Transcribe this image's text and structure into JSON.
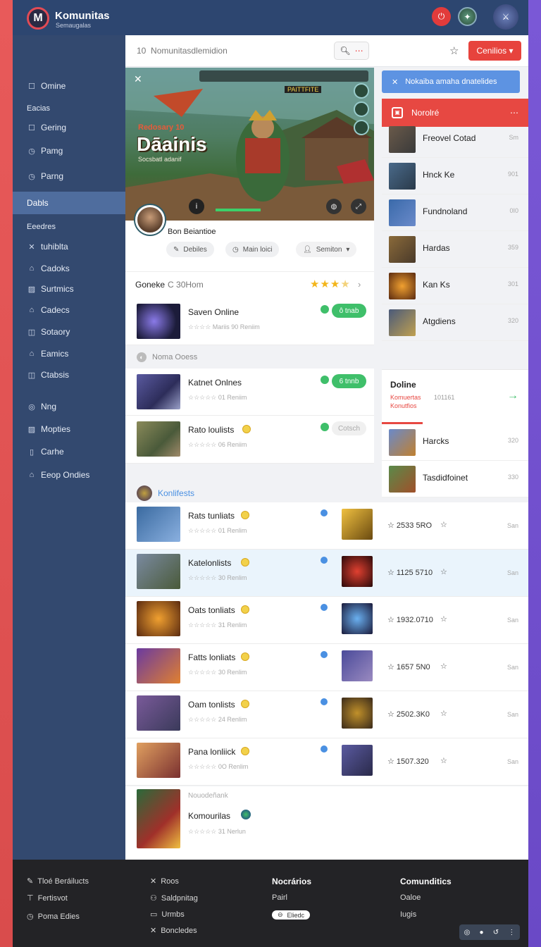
{
  "app": {
    "title": "Komunitas",
    "subtitle": "Semaugalas"
  },
  "topbar": {
    "icons": [
      "notification-icon",
      "guild-badge-icon",
      "sword-emblem-icon"
    ]
  },
  "sidebar": {
    "items": [
      {
        "label": "Omine",
        "icon": "square-icon"
      },
      {
        "label": "Eacias",
        "icon": ""
      },
      {
        "label": "Gering",
        "icon": "square-icon"
      },
      {
        "label": "Pamg",
        "icon": "clock-icon"
      },
      {
        "label": "Parng",
        "icon": "clock-icon"
      },
      {
        "label": "Dabls",
        "icon": ""
      },
      {
        "label": "Eeedres",
        "icon": ""
      },
      {
        "label": "tuhiblta",
        "icon": "crossed-swords-icon"
      },
      {
        "label": "Cadoks",
        "icon": "house-icon"
      },
      {
        "label": "Surtmics",
        "icon": "image-icon"
      },
      {
        "label": "Cadecs",
        "icon": "house-icon"
      },
      {
        "label": "Sotaory",
        "icon": "book-icon"
      },
      {
        "label": "Eamics",
        "icon": "house-icon"
      },
      {
        "label": "Ctabsis",
        "icon": "book-icon"
      },
      {
        "label": "Nng",
        "icon": "check-circle-icon"
      },
      {
        "label": "Mopties",
        "icon": "image-icon"
      },
      {
        "label": "Carhe",
        "icon": "doc-icon"
      },
      {
        "label": "Eeop Ondies",
        "icon": "house-icon"
      }
    ]
  },
  "search": {
    "prefix": "10",
    "text": "Nomunitasdlemidion",
    "button_glyph": "⋯"
  },
  "toolbar": {
    "cta_label": "Cenilios"
  },
  "hero": {
    "kicker": "Redosary 10",
    "title": "Dāainis",
    "subtitle": "Socsbatl adanif",
    "hud_text": "PAITTFITE"
  },
  "profile": {
    "name": "Bon Beiantioe",
    "chips": [
      "Debiles",
      "Main loici",
      "Semiton"
    ]
  },
  "card": {
    "title": "Goneke",
    "subtitle": "C 30Hom",
    "rating": 3.5
  },
  "featured_rows": [
    {
      "title": "Saven Online",
      "meta": "Mariis 90  Reniim",
      "pill": "ô tnab",
      "pill_color": "#3fbf6a"
    }
  ],
  "section_two_label": "Noma Ooess",
  "section_two_rows": [
    {
      "title": "Katnet Onlnes",
      "meta": "01  Reniim",
      "pill": "6 tnnb",
      "pill_color": "#3fbf6a"
    },
    {
      "title": "Rato loulists",
      "meta": "06  Reniim",
      "pill": "Cotsch",
      "pill_color": "#f0f0f0"
    }
  ],
  "right_panel": {
    "notice": "Nokaiba amaha dnatelides",
    "header": "Norolré",
    "items": [
      {
        "title": "Freovel Cotad",
        "value": "Sm"
      },
      {
        "title": "Hnck Ke",
        "value": "901"
      },
      {
        "title": "Fundnoland",
        "value": "0I0"
      },
      {
        "title": "Hardas",
        "value": "359"
      },
      {
        "title": "Kan Ks",
        "value": "301"
      },
      {
        "title": "Atgdiens",
        "value": "320"
      }
    ],
    "online_title": "Doline",
    "online_line1": "Komuertas",
    "online_line2": "Konutfios",
    "online_count": "101161",
    "items2": [
      {
        "title": "Harcks",
        "value": "320"
      },
      {
        "title": "Tasdidfoinet",
        "value": "330"
      }
    ]
  },
  "community_label": "Konlifests",
  "table_rows": [
    {
      "title": "Rats tunliats",
      "meta": "01  Renlim",
      "value": "2533 5RO",
      "end": "San"
    },
    {
      "title": "Katelonlists",
      "meta": "30  Renlim",
      "value": "1125 5710",
      "end": "San"
    },
    {
      "title": "Oats tonliats",
      "meta": "31  Renlim",
      "value": "1932.0710",
      "end": "San"
    },
    {
      "title": "Fatts lonliats",
      "meta": "30  Renlim",
      "value": "1657 5N0",
      "end": "San"
    },
    {
      "title": "Oam tonlists",
      "meta": "24  Renlim",
      "value": "2502.3K0",
      "end": "San"
    },
    {
      "title": "Pana lonliick",
      "meta": "0O  Renlim",
      "value": "1507.320",
      "end": "San"
    }
  ],
  "last_row": {
    "pre": "Nouodeñank",
    "title": "Komourilas",
    "meta": "31  Nerlun"
  },
  "footer": {
    "col1": [
      "Tloé Beráilucts",
      "Fertisvot",
      "Poma Edies"
    ],
    "col2": [
      "Roos",
      "Saldpnitag",
      "Urmbs",
      "Boncledes"
    ],
    "col3_head": "Nocrários",
    "col3": [
      "Pairl",
      "Eliedc"
    ],
    "col4_head": "Comunditics",
    "col4": [
      "Oaloe",
      "Iugis"
    ]
  }
}
